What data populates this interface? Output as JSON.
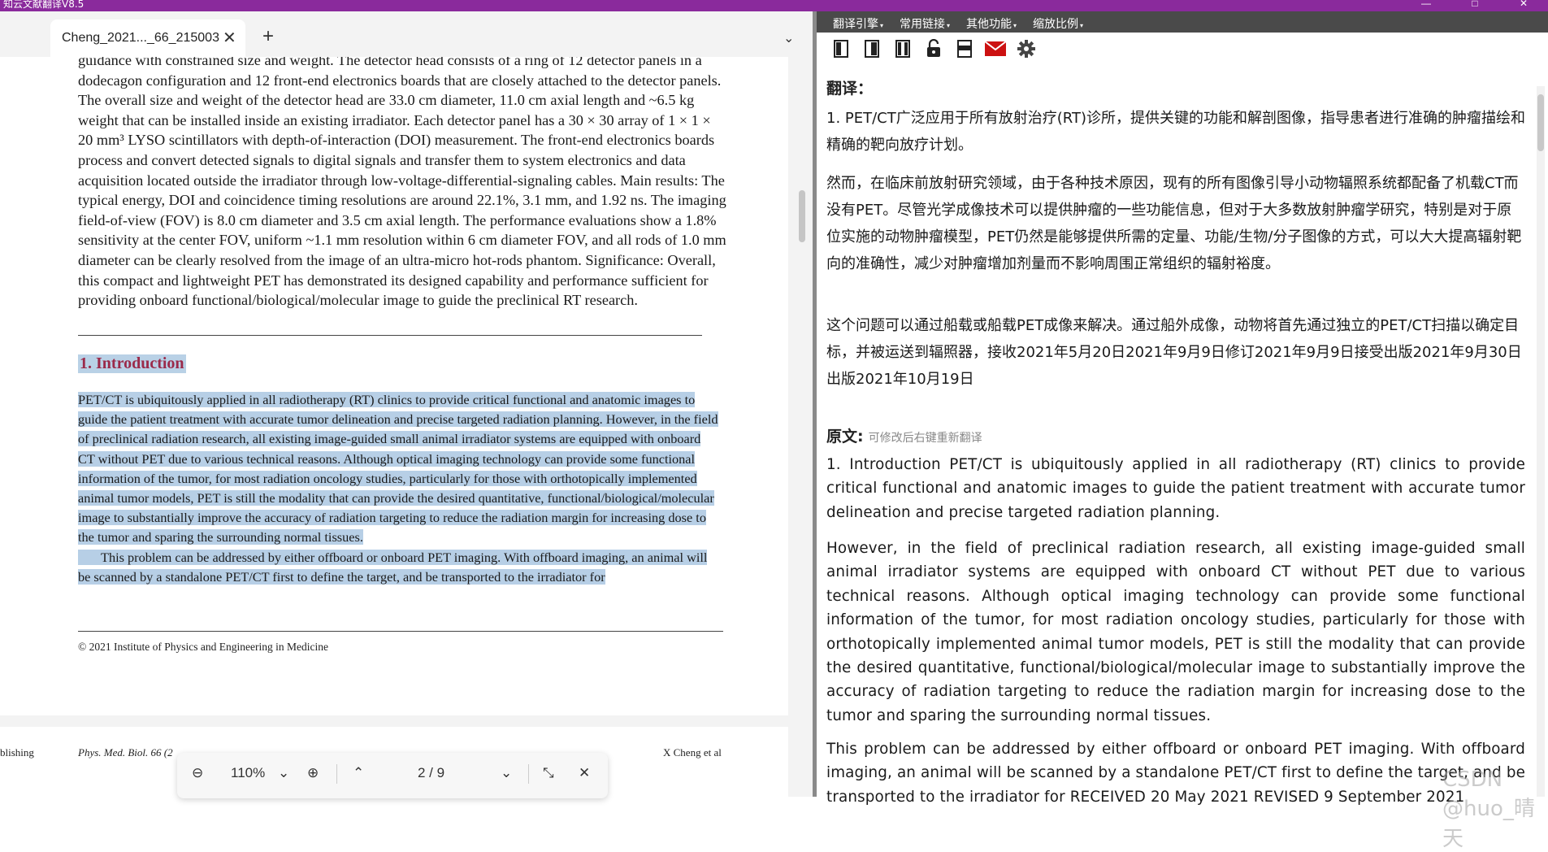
{
  "app": {
    "title": "知云文献翻译V8.5",
    "minimize": "—",
    "maximize": "□",
    "close": "✕"
  },
  "pdf": {
    "tab_title": "Cheng_2021..._66_215003",
    "tab_close": "✕",
    "tab_new": "+",
    "tab_dropdown": "⌄",
    "top_text": "guidance with constrained size and weight. The detector head consists of a ring of 12 detector panels in a dodecagon configuration and 12 front-end electronics boards that are closely attached to the detector panels. The overall size and weight of the detector head are 33.0 cm diameter, 11.0 cm axial length and ~6.5 kg weight that can be installed inside an existing irradiator. Each detector panel has a 30 × 30 array of 1 × 1 × 20 mm³ LYSO scintillators with depth-of-interaction (DOI) measurement. The front-end electronics boards process and convert detected signals to digital signals and transfer them to system electronics and data acquisition located outside the irradiator through low-voltage-differential-signaling cables. Main results: The typical energy, DOI and coincidence timing resolutions are around 22.1%, 3.1 mm, and 1.92 ns. The imaging field-of-view (FOV) is 8.0 cm diameter and 3.5 cm axial length. The performance evaluations show a 1.8% sensitivity at the center FOV, uniform ~1.1 mm resolution within 6 cm diameter FOV, and all rods of 1.0 mm diameter can be clearly resolved from the image of an ultra-micro hot-rods phantom. Significance: Overall, this compact and lightweight PET has demonstrated its designed capability and performance sufficient for providing onboard functional/biological/molecular image to guide the preclinical RT research.",
    "section_heading": "1. Introduction",
    "intro_p1": "PET/CT is ubiquitously applied in all radiotherapy (RT) clinics to provide critical functional and anatomic images to guide the patient treatment with accurate tumor delineation and precise targeted radiation planning. However, in the field of preclinical radiation research, all existing image-guided small animal irradiator systems are equipped with onboard CT without PET due to various technical reasons. Although optical imaging technology can provide some functional information of the tumor, for most radiation oncology studies, particularly for those with orthotopically implemented animal tumor models, PET is still the modality that can provide the desired quantitative, functional/biological/molecular image to substantially improve the accuracy of radiation targeting to reduce the radiation margin for increasing dose to the tumor and sparing the surrounding normal tissues.",
    "intro_p2": "This problem can be addressed by either offboard or onboard PET imaging. With offboard imaging, an animal will be scanned by a standalone PET/CT first to define the target, and be transported to the irradiator for",
    "copyright": "© 2021 Institute of Physics and Engineering in Medicine",
    "page2_left": "blishing",
    "page2_journal": "Phys. Med. Biol. 66 (2",
    "page2_author": "X Cheng et al",
    "toolbar": {
      "zoom_out": "⊖",
      "zoom": "110%",
      "zoom_dd": "⌄",
      "zoom_in": "⊕",
      "prev": "⌃",
      "page": "2 / 9",
      "next": "⌄",
      "fit": "⤡",
      "close": "✕"
    }
  },
  "translator": {
    "menus": [
      "翻译引擎",
      "常用链接",
      "其他功能",
      "缩放比例"
    ],
    "menu_caret": "▾",
    "toolbar_icons": [
      "page-left-icon",
      "page-single-icon",
      "page-double-icon",
      "unlock-icon",
      "window-icon",
      "mail-icon",
      "gear-icon"
    ],
    "translation_label": "翻译：",
    "translation_paras": [
      "1. PET/CT广泛应用于所有放射治疗(RT)诊所，提供关键的功能和解剖图像，指导患者进行准确的肿瘤描绘和精确的靶向放疗计划。",
      "然而，在临床前放射研究领域，由于各种技术原因，现有的所有图像引导小动物辐照系统都配备了机载CT而没有PET。尽管光学成像技术可以提供肿瘤的一些功能信息，但对于大多数放射肿瘤学研究，特别是对于原位实施的动物肿瘤模型，PET仍然是能够提供所需的定量、功能/生物/分子图像的方式，可以大大提高辐射靶向的准确性，减少对肿瘤增加剂量而不影响周围正常组织的辐射裕度。",
      "这个问题可以通过船载或船载PET成像来解决。通过船外成像，动物将首先通过独立的PET/CT扫描以确定目标，并被运送到辐照器，接收2021年5月20日2021年9月9日修订2021年9月9日接受出版2021年9月30日出版2021年10月19日"
    ],
    "original_label": "原文:",
    "original_hint": "可修改后右键重新翻译",
    "original_paras": [
      "1. Introduction PET/CT is ubiquitously applied in all radiotherapy (RT) clinics to provide critical functional and anatomic images to guide the patient treatment with accurate tumor delineation and precise targeted radiation planning.",
      "However, in the field of preclinical radiation research, all existing image-guided small animal irradiator systems are equipped with onboard CT without PET due to various technical reasons. Although optical imaging technology can provide some functional information of the tumor, for most radiation oncology studies, particularly for those with orthotopically implemented animal tumor models, PET is still the modality that can provide the desired quantitative, functional/biological/molecular image to substantially improve the accuracy of radiation targeting to reduce the radiation margin for increasing dose to the tumor and sparing the surrounding normal tissues.",
      "This problem can be addressed by either offboard or onboard PET imaging. With offboard imaging, an animal will be scanned by a standalone PET/CT first to define the target, and be transported to the irradiator for RECEIVED 20 May 2021 REVISED 9 September 2021"
    ],
    "watermark": "CSDN @huo_晴天",
    "colors": {
      "menubar": "#4a4a4a",
      "mail": "#cc1111",
      "titlebar": "#8a2a9c",
      "highlight": "#b7cfe6"
    }
  }
}
